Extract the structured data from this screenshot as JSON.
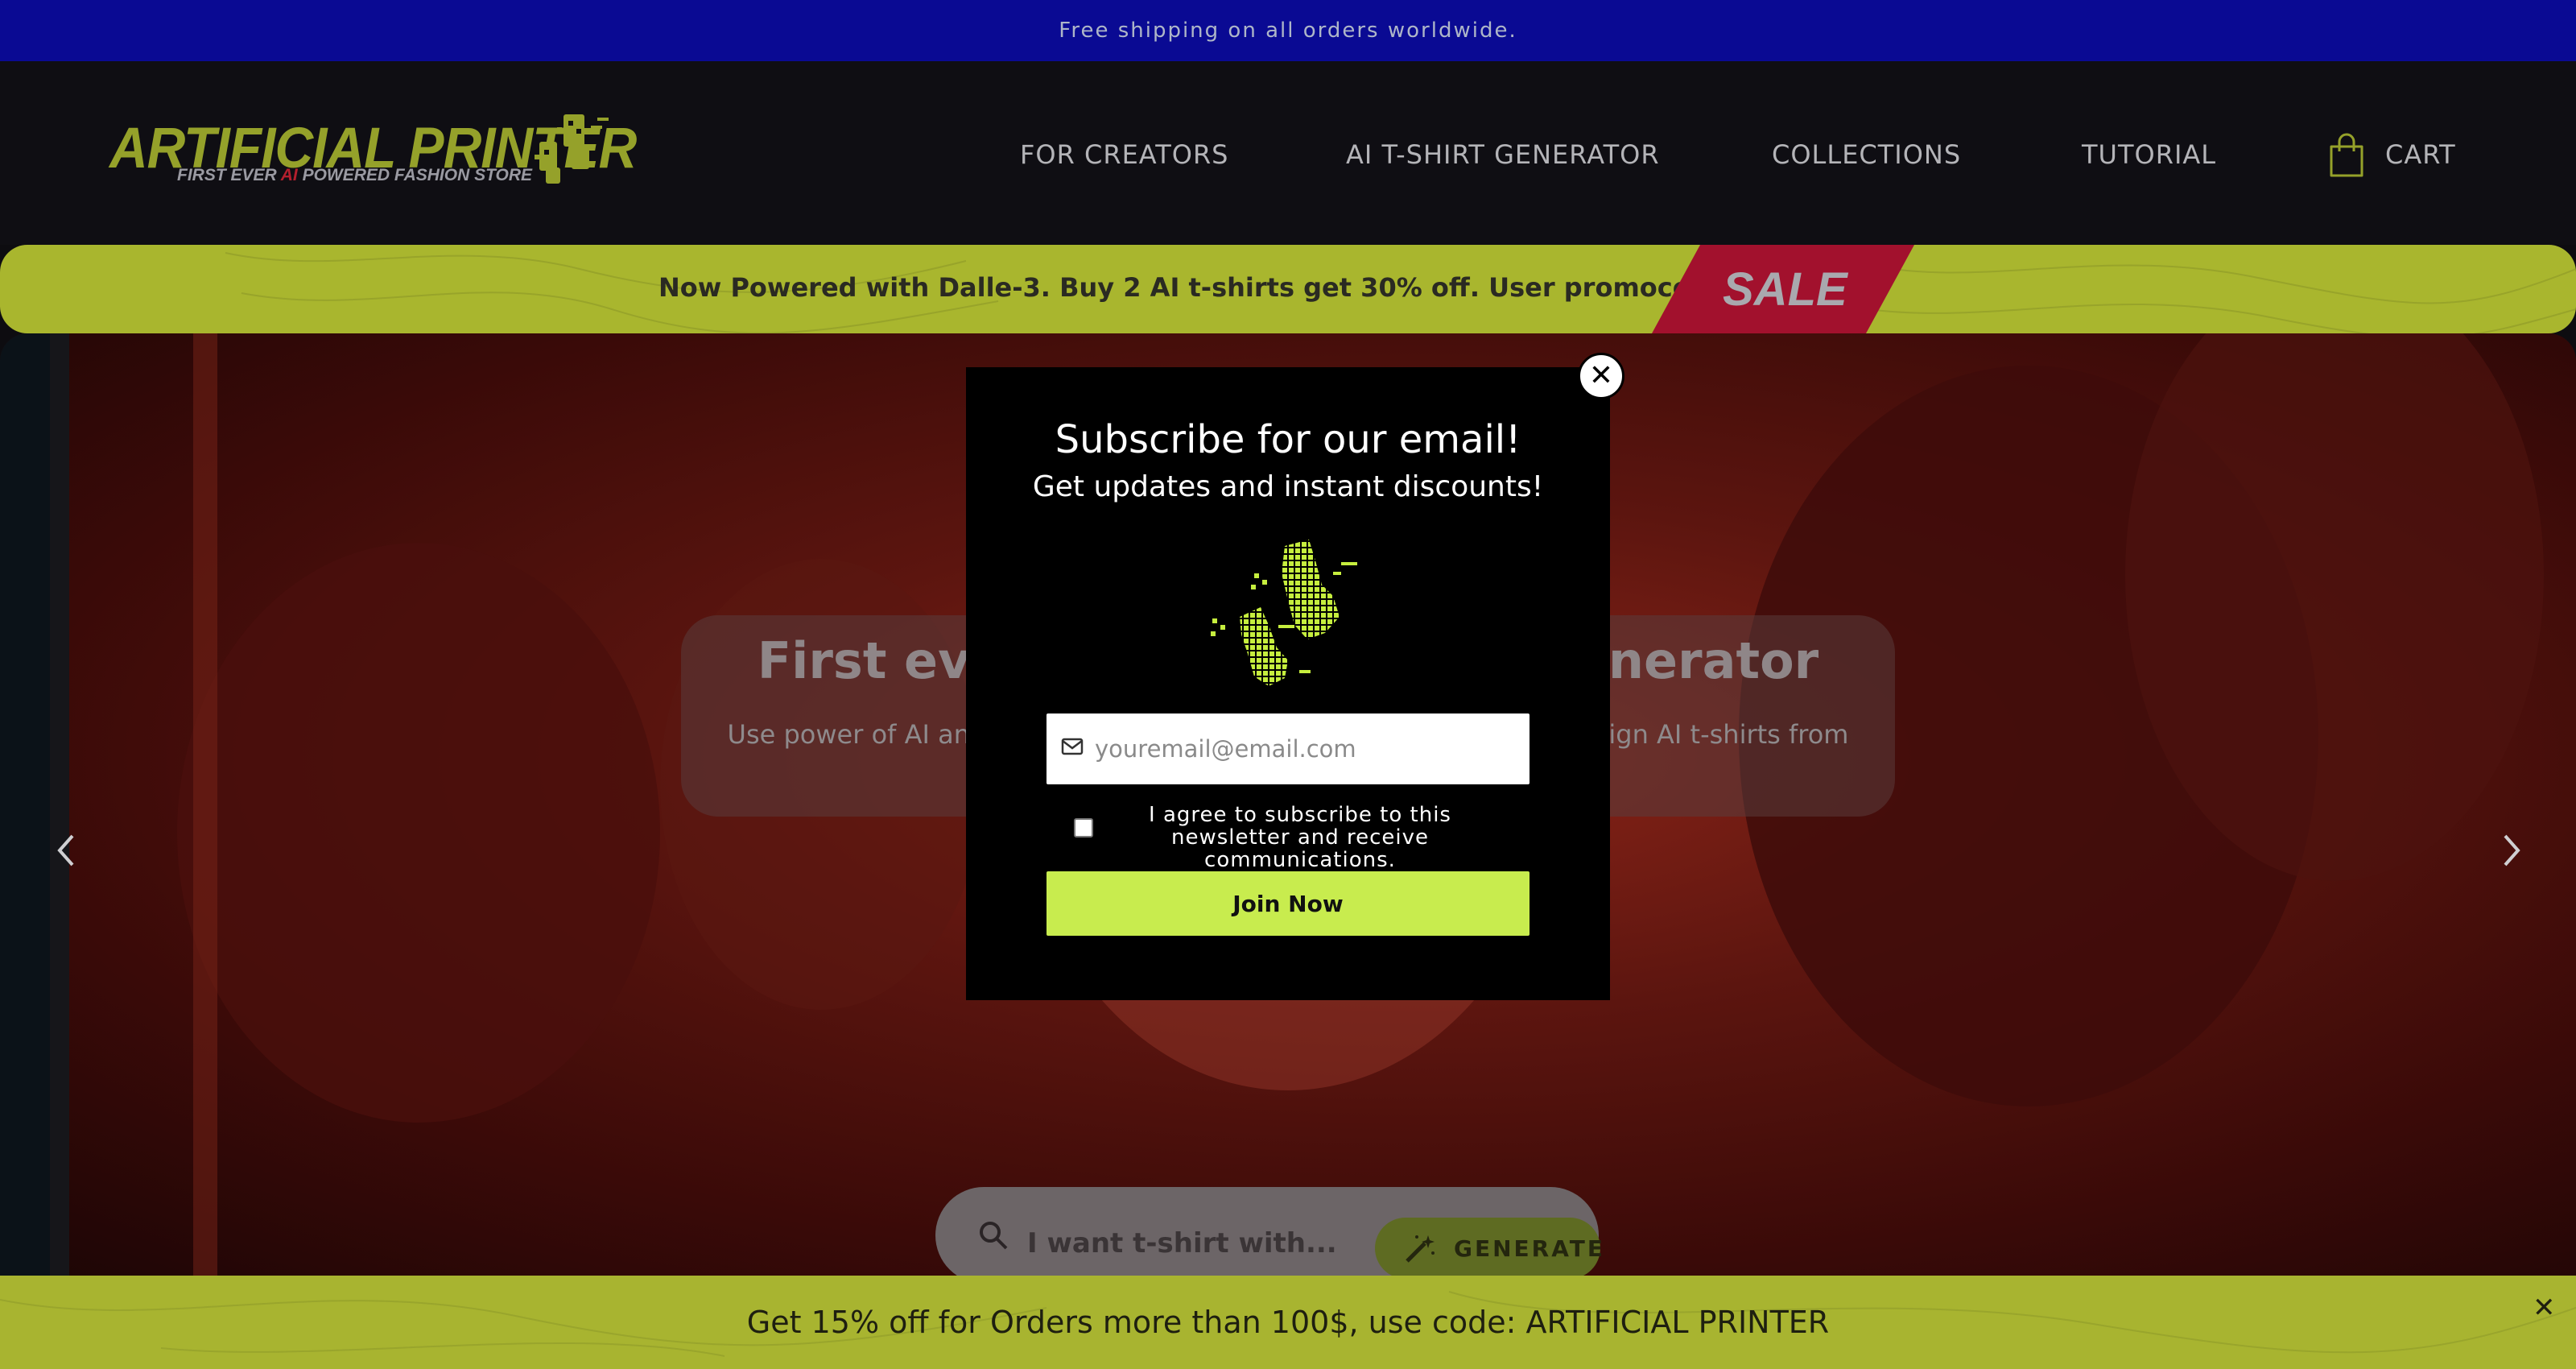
{
  "announcement": {
    "text": "Free shipping on all orders worldwide."
  },
  "header": {
    "logo_title": "ARTIFICIAL PRINTER",
    "logo_sub_before": "FIRST EVER ",
    "logo_sub_ai": "AI",
    "logo_sub_after": " POWERED FASHION STORE",
    "nav": [
      "FOR CREATORS",
      "AI T-SHIRT GENERATOR",
      "COLLECTIONS",
      "TUTORIAL"
    ],
    "cart_label": "CART"
  },
  "promo": {
    "text": "Now Powered with Dalle-3. Buy 2 AI t-shirts get 30% off. User promocode: DALLE",
    "sale_label": "SALE"
  },
  "hero": {
    "title": "First ever AI T-Shirt Design Generator",
    "description": "Use power of AI and latest Stable Diffusion and Dall-E models to design AI t-shirts from your dreams",
    "search_placeholder": "I want t-shirt with...",
    "generate_label": "GENERATE"
  },
  "modal": {
    "close_symbol": "✕",
    "title": "Subscribe for our email!",
    "subtitle": "Get updates and instant discounts!",
    "email_placeholder": "youremail@email.com",
    "agree_text": "I agree to subscribe to this newsletter and receive communications.",
    "join_label": "Join Now"
  },
  "footer_bar": {
    "text": "Get 15% off for Orders more than 100$, use code: ARTIFICIAL PRINTER",
    "close_symbol": "✕"
  },
  "colors": {
    "announcement_bg": "#0a0a93",
    "brand_green": "#c8ec4e",
    "sale_red": "#a2112d"
  }
}
